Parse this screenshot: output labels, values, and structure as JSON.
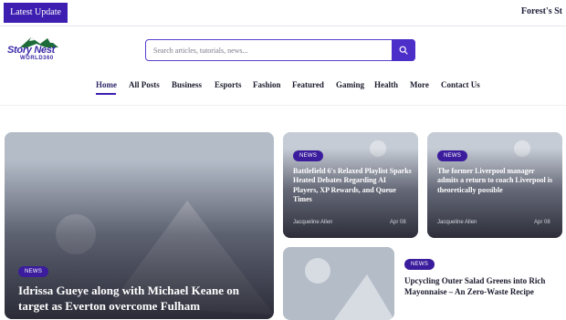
{
  "topbar": {
    "latest_label": "Latest Update",
    "ticker_text": "Forest's St"
  },
  "brand": {
    "logo_line1": "Story Nest",
    "logo_line2": "WORLD360",
    "colors": {
      "accent": "#3d1eb0",
      "logo_green": "#1e6b3a",
      "logo_text": "#3a2aa8"
    }
  },
  "search": {
    "placeholder": "Search articles, tutorials, news...",
    "icon": "search-icon"
  },
  "nav": {
    "items": [
      "Home",
      "All Posts",
      "Business",
      "Esports",
      "Fashion",
      "Featured",
      "Gaming",
      "Health",
      "More",
      "Contact Us"
    ],
    "active": "Home"
  },
  "articles": {
    "main": {
      "badge": "NEWS",
      "title": "Idrissa Gueye along with Michael Keane on target as Everton overcome Fulham"
    },
    "card1": {
      "badge": "NEWS",
      "title": "Battlefield 6's Relaxed Playlist Sparks Heated Debates Regarding AI Players, XP Rewards, and Queue Times",
      "author": "Jacqueline Allen",
      "date": "Apr 08"
    },
    "card2": {
      "badge": "NEWS",
      "title": "The former Liverpool manager admits a return to coach Liverpool is theoretically possible",
      "author": "Jacqueline Allen",
      "date": "Apr 08"
    },
    "card3": {
      "badge": "NEWS",
      "title": "Upcycling Outer Salad Greens into Rich Mayonnaise – An Zero-Waste Recipe"
    }
  }
}
